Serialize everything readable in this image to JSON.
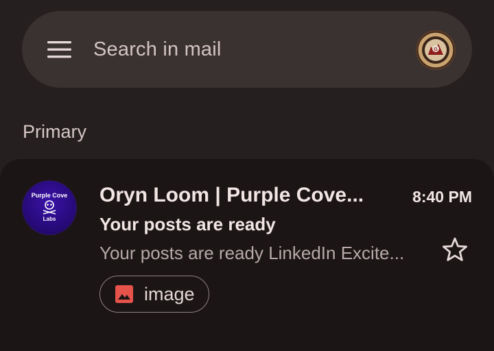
{
  "search": {
    "placeholder": "Search in mail",
    "menu_icon": "hamburger-menu-icon",
    "avatar_icon": "account-avatar"
  },
  "section": {
    "label": "Primary"
  },
  "email": {
    "sender": "Oryn Loom | Purple Cove...",
    "time": "8:40 PM",
    "subject": "Your posts are ready",
    "snippet": "Your posts are ready LinkedIn Excite...",
    "starred": false,
    "sender_avatar": {
      "top_text": "Purple Cove",
      "bottom_text": "Labs",
      "color": "#2a0b7f"
    },
    "attachment": {
      "label": "image",
      "icon": "image-icon",
      "icon_color": "#e5534b"
    }
  },
  "colors": {
    "background": "#261f1f",
    "search_bar": "#3a3231",
    "card": "#1b1516",
    "text_primary": "#f2e6e4",
    "text_secondary": "#b7a9a7"
  }
}
